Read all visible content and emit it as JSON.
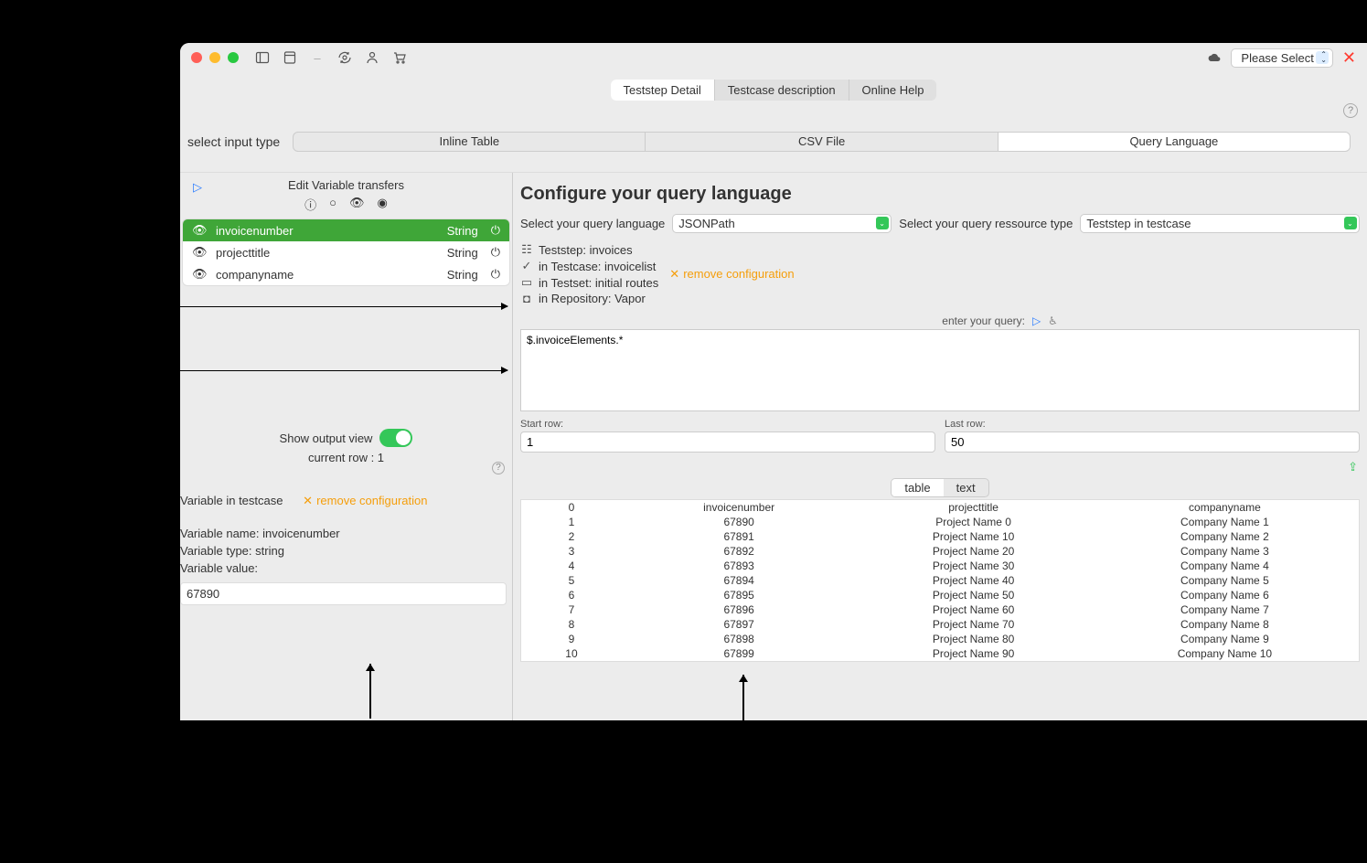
{
  "titlebar": {
    "select_label": "Please Select"
  },
  "tabs": {
    "teststep_detail": "Teststep Detail",
    "testcase_description": "Testcase description",
    "online_help": "Online Help"
  },
  "input_type": {
    "label": "select input type",
    "inline": "Inline Table",
    "csv": "CSV File",
    "query": "Query Language"
  },
  "left": {
    "header": "Edit Variable transfers",
    "vars": [
      {
        "name": "invoicenumber",
        "type": "String"
      },
      {
        "name": "projecttitle",
        "type": "String"
      },
      {
        "name": "companyname",
        "type": "String"
      }
    ],
    "show_output": "Show output view",
    "current_row": "current row : 1",
    "lower": {
      "line1": "Variable in  testcase",
      "remove": "remove configuration",
      "name_line": "Variable name: invoicenumber",
      "type_line": "Variable type: string",
      "value_label": "Variable value:",
      "value": "67890"
    }
  },
  "right": {
    "title": "Configure your query language",
    "ql_label": "Select your query language",
    "ql_value": "JSONPath",
    "rt_label": "Select your query ressource type",
    "rt_value": "Teststep in testcase",
    "context": {
      "teststep": "Teststep: invoices",
      "testcase": "in Testcase: invoicelist",
      "testset": "in Testset: initial routes",
      "repo": "in Repository: Vapor"
    },
    "remove": "remove configuration",
    "enter_query": "enter your query:",
    "query": "$.invoiceElements.*",
    "start_label": "Start row:",
    "start_value": "1",
    "last_label": "Last row:",
    "last_value": "50",
    "view_table": "table",
    "view_text": "text",
    "table": {
      "headers": [
        "0",
        "invoicenumber",
        "projecttitle",
        "companyname"
      ],
      "rows": [
        [
          "1",
          "67890",
          "Project Name 0",
          "Company Name 1"
        ],
        [
          "2",
          "67891",
          "Project Name 10",
          "Company Name 2"
        ],
        [
          "3",
          "67892",
          "Project Name 20",
          "Company Name 3"
        ],
        [
          "4",
          "67893",
          "Project Name 30",
          "Company Name 4"
        ],
        [
          "5",
          "67894",
          "Project Name 40",
          "Company Name 5"
        ],
        [
          "6",
          "67895",
          "Project Name 50",
          "Company Name 6"
        ],
        [
          "7",
          "67896",
          "Project Name 60",
          "Company Name 7"
        ],
        [
          "8",
          "67897",
          "Project Name 70",
          "Company Name 8"
        ],
        [
          "9",
          "67898",
          "Project Name 80",
          "Company Name 9"
        ],
        [
          "10",
          "67899",
          "Project Name 90",
          "Company Name 10"
        ]
      ]
    }
  }
}
